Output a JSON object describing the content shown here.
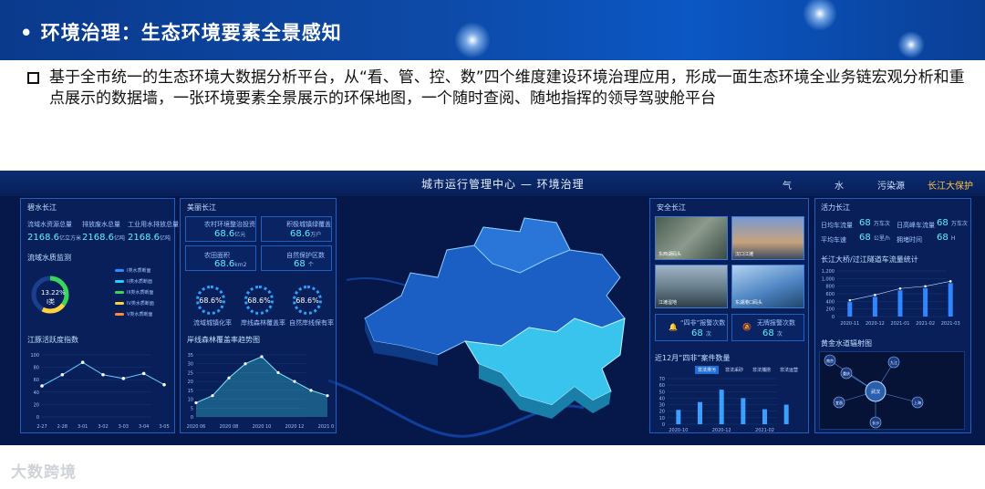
{
  "slide": {
    "title": "• 环境治理：生态环境要素全景感知",
    "description": "基于全市统一的生态环境大数据分析平台，从“看、管、控、数”四个维度建设环境治理应用，形成一面生态环境全业务链宏观分析和重点展示的数据墙，一张环境要素全景展示的环保地图，一个随时查阅、随地指挥的领导驾驶舱平台"
  },
  "dashboard": {
    "title": "城市运行管理中心 —   环境治理",
    "nav": [
      "气",
      "水",
      "污染源",
      "长江大保护"
    ],
    "active_nav": "长江大保护",
    "left": {
      "title": "碧水长江",
      "stats": [
        {
          "label": "流域水资源总量",
          "value": "2168.6",
          "unit": "亿立方米"
        },
        {
          "label": "排放废水总量",
          "value": "2168.6",
          "unit": "亿吨"
        },
        {
          "label": "工业用水排放总量",
          "value": "2168.6",
          "unit": "亿吨"
        }
      ],
      "water_title": "流域水质监测",
      "ring_value": "13.22%",
      "ring_label": "I类",
      "water_legend": [
        "I类水质断面",
        "II类水质断面",
        "III类水质断面",
        "IV类水质断面",
        "V类水质断面"
      ],
      "index_title": "江豚活跃度指数",
      "index_chart": {
        "type": "line",
        "categories": [
          "2-27",
          "2-28",
          "3-01",
          "3-02",
          "3-03",
          "3-04",
          "3-05"
        ],
        "values": [
          50,
          68,
          88,
          68,
          62,
          70,
          52
        ],
        "yticks": [
          "100",
          "80",
          "60",
          "40",
          "20",
          "0"
        ],
        "ylim": [
          0,
          100
        ]
      }
    },
    "mid_left": {
      "title": "美丽长江",
      "cards": [
        {
          "label": "农村环境整治投资",
          "value": "68.6",
          "unit": "亿元"
        },
        {
          "label": "积极城镇绿覆盖",
          "value": "68.6",
          "unit": "万户"
        },
        {
          "label": "农田面积",
          "value": "68.6",
          "unit": "km2"
        },
        {
          "label": "自然保护区数",
          "value": "68",
          "unit": "个"
        }
      ],
      "gauges": [
        {
          "value": "68.6%",
          "label": "流域城镇化率"
        },
        {
          "value": "68.6%",
          "label": "岸线森林覆盖率"
        },
        {
          "value": "68.6%",
          "label": "自然岸线保有率"
        }
      ],
      "trend_title": "岸线森林覆盖率趋势图",
      "trend_chart": {
        "type": "area",
        "categories": [
          "2020 06",
          "2020 08",
          "2020 10",
          "2020 12",
          "2021 02"
        ],
        "points": [
          8,
          12,
          22,
          30,
          34,
          25,
          20,
          15,
          12
        ],
        "yticks": [
          "35",
          "30",
          "25",
          "20",
          "15",
          "10",
          "5",
          "0"
        ],
        "ylim": [
          0,
          35
        ]
      }
    },
    "right_a": {
      "title": "安全长江",
      "photos": [
        "东西湖码头",
        "汉口江滩",
        "江滩湿地",
        "东湖港口码头"
      ],
      "alerts": [
        {
          "label": "“四非”报警次数",
          "value": "68",
          "unit": "次"
        },
        {
          "label": "无牌报警次数",
          "value": "68",
          "unit": "次"
        }
      ],
      "case_title": "近12月“四非”案件数量",
      "case_tabs": [
        "非法排污",
        "非法采砂",
        "非法捕捞",
        "非法运营"
      ],
      "case_chart": {
        "type": "bar",
        "categories": [
          "2020-10",
          "2020-11",
          "2020-12",
          "2021-01",
          "2021-02",
          "2021-03"
        ],
        "values": [
          22,
          34,
          53,
          40,
          23,
          30
        ],
        "xticks": [
          "2020-10",
          "2020-12",
          "2021-02"
        ],
        "yticks": [
          "70",
          "60",
          "50",
          "40",
          "30",
          "20",
          "10",
          "0"
        ],
        "ylim": [
          0,
          70
        ]
      }
    },
    "right_b": {
      "title": "活力长江",
      "stats": [
        {
          "label": "日均车流量",
          "value": "68",
          "unit": "万车次"
        },
        {
          "label": "日高峰车流量",
          "value": "68",
          "unit": "万车次"
        },
        {
          "label": "平均车速",
          "value": "68",
          "unit": "公里/h"
        },
        {
          "label": "拥堵时间",
          "value": "68",
          "unit": "H"
        }
      ],
      "traffic_title": "长江大桥/过江隧道车流量统计",
      "traffic_chart": {
        "type": "bar",
        "categories": [
          "2020-11",
          "2020-12",
          "2021-01",
          "2021-02",
          "2021-03"
        ],
        "values": [
          380,
          520,
          690,
          750,
          880
        ],
        "yticks": [
          "1,200",
          "1,000",
          "800",
          "600",
          "400",
          "200",
          "0"
        ],
        "ylim": [
          0,
          1200
        ]
      },
      "network_title": "黄金水道辐射图",
      "network_center": "武汉",
      "network_nodes": [
        "南京",
        "重庆",
        "宜昌",
        "上海",
        "九江",
        "长沙"
      ]
    }
  },
  "watermark": "大数跨境"
}
